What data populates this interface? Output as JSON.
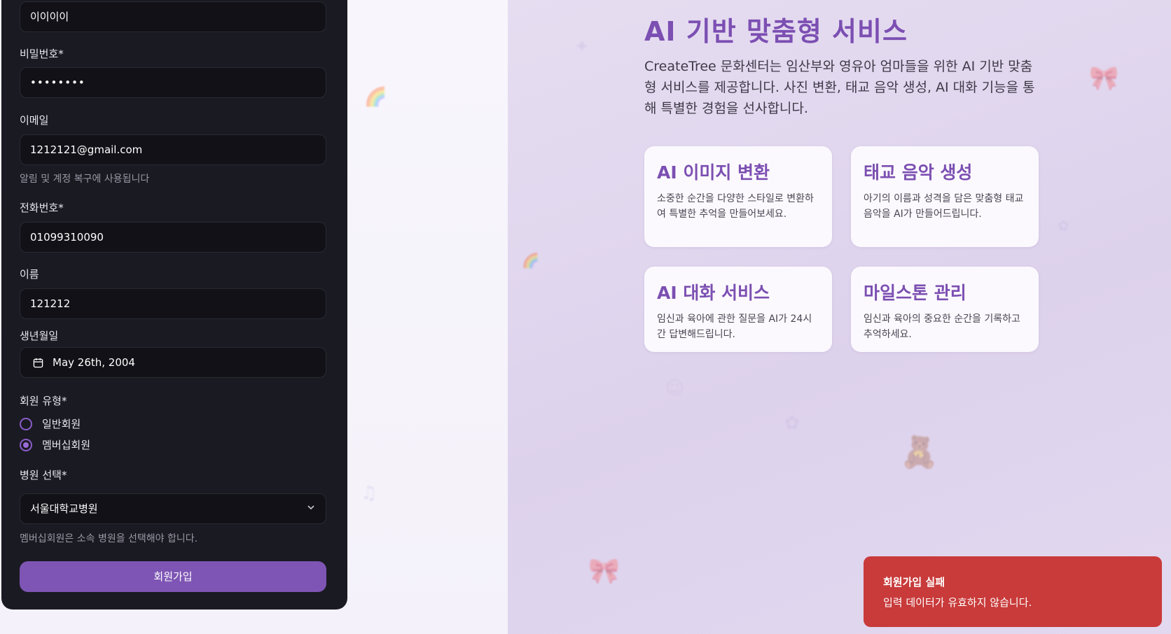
{
  "form": {
    "top_input_value": "이이이이",
    "password": {
      "label": "비밀번호*",
      "value": "••••••••"
    },
    "email": {
      "label": "이메일",
      "value": "1212121@gmail.com",
      "hint": "알림 및 계정 복구에 사용됩니다"
    },
    "phone": {
      "label": "전화번호*",
      "value": "01099310090"
    },
    "name": {
      "label": "이름",
      "value": "121212"
    },
    "birthdate": {
      "label": "생년월일",
      "value": "May 26th, 2004"
    },
    "member_type": {
      "label": "회원 유형*",
      "options": [
        {
          "label": "일반회원",
          "checked": false
        },
        {
          "label": "멤버십회원",
          "checked": true
        }
      ]
    },
    "hospital": {
      "label": "병원 선택*",
      "value": "서울대학교병원",
      "hint": "멤버십회원은 소속 병원을 선택해야 합니다."
    },
    "submit_label": "회원가입"
  },
  "hero": {
    "title": "AI 기반 맞춤형 서비스",
    "description": "CreateTree 문화센터는 임산부와 영유아 엄마들을 위한 AI 기반 맞춤형 서비스를 제공합니다. 사진 변환, 태교 음악 생성, AI 대화 기능을 통해 특별한 경험을 선사합니다."
  },
  "cards": [
    {
      "title": "AI 이미지 변환",
      "description": "소중한 순간을 다양한 스타일로 변환하여 특별한 추억을 만들어보세요."
    },
    {
      "title": "태교 음악 생성",
      "description": "아기의 이름과 성격을 담은 맞춤형 태교 음악을 AI가 만들어드립니다."
    },
    {
      "title": "AI 대화 서비스",
      "description": "임신과 육아에 관한 질문을 AI가 24시간 답변해드립니다."
    },
    {
      "title": "마일스톤 관리",
      "description": "임신과 육아의 중요한 순간을 기록하고 추억하세요."
    }
  ],
  "toast": {
    "title": "회원가입 실패",
    "message": "입력 데이터가 유효하지 않습니다."
  },
  "colors": {
    "accent": "#7e55b4",
    "title_purple": "#7c4fb2",
    "panel_bg": "#1a1a22",
    "toast_bg": "#c93a3a"
  },
  "icons": [
    "calendar-icon",
    "chevron-down-icon"
  ]
}
